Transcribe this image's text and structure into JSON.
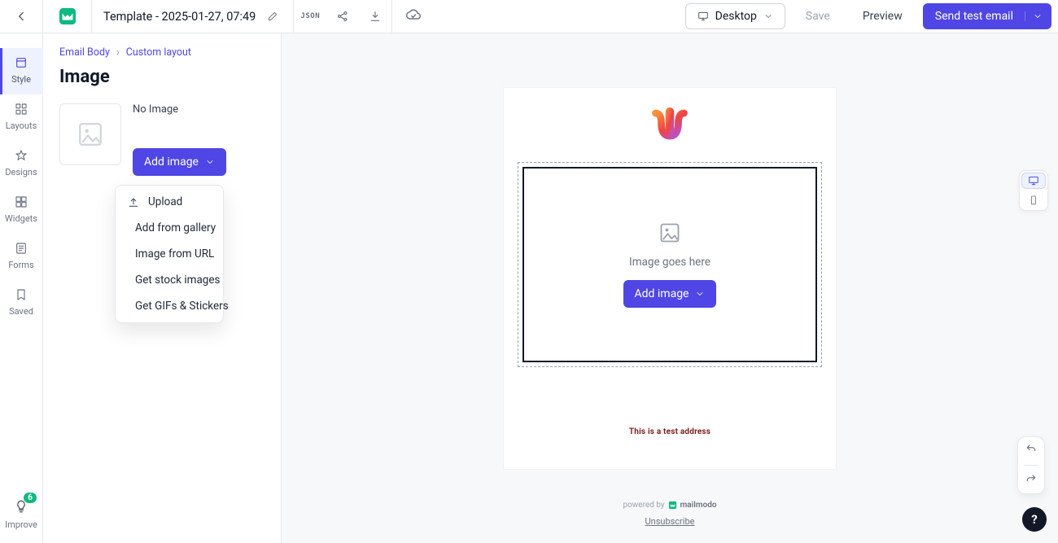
{
  "header": {
    "title": "Template - 2025-01-27, 07:49",
    "device_label": "Desktop",
    "save_label": "Save",
    "preview_label": "Preview",
    "send_label": "Send test email",
    "json_badge": "JSON"
  },
  "rail": {
    "items": [
      {
        "label": "Style"
      },
      {
        "label": "Layouts"
      },
      {
        "label": "Designs"
      },
      {
        "label": "Widgets"
      },
      {
        "label": "Forms"
      },
      {
        "label": "Saved"
      }
    ],
    "improve_label": "Improve",
    "improve_badge": "6"
  },
  "sidepanel": {
    "crumbs": {
      "body": "Email Body",
      "custom": "Custom layout"
    },
    "heading": "Image",
    "noimage_label": "No Image",
    "add_btn": "Add image",
    "dropdown": [
      "Upload",
      "Add from gallery",
      "Image from URL",
      "Get stock images",
      "Get GIFs & Stickers"
    ]
  },
  "canvas": {
    "placeholder": "Image goes here",
    "add_btn": "Add image",
    "test_address": "This is a test address",
    "powered_by": "powered by",
    "brand": "mailmodo",
    "unsubscribe": "Unsubscribe"
  },
  "colors": {
    "indigo": "#4f46e5",
    "green": "#10b981"
  }
}
